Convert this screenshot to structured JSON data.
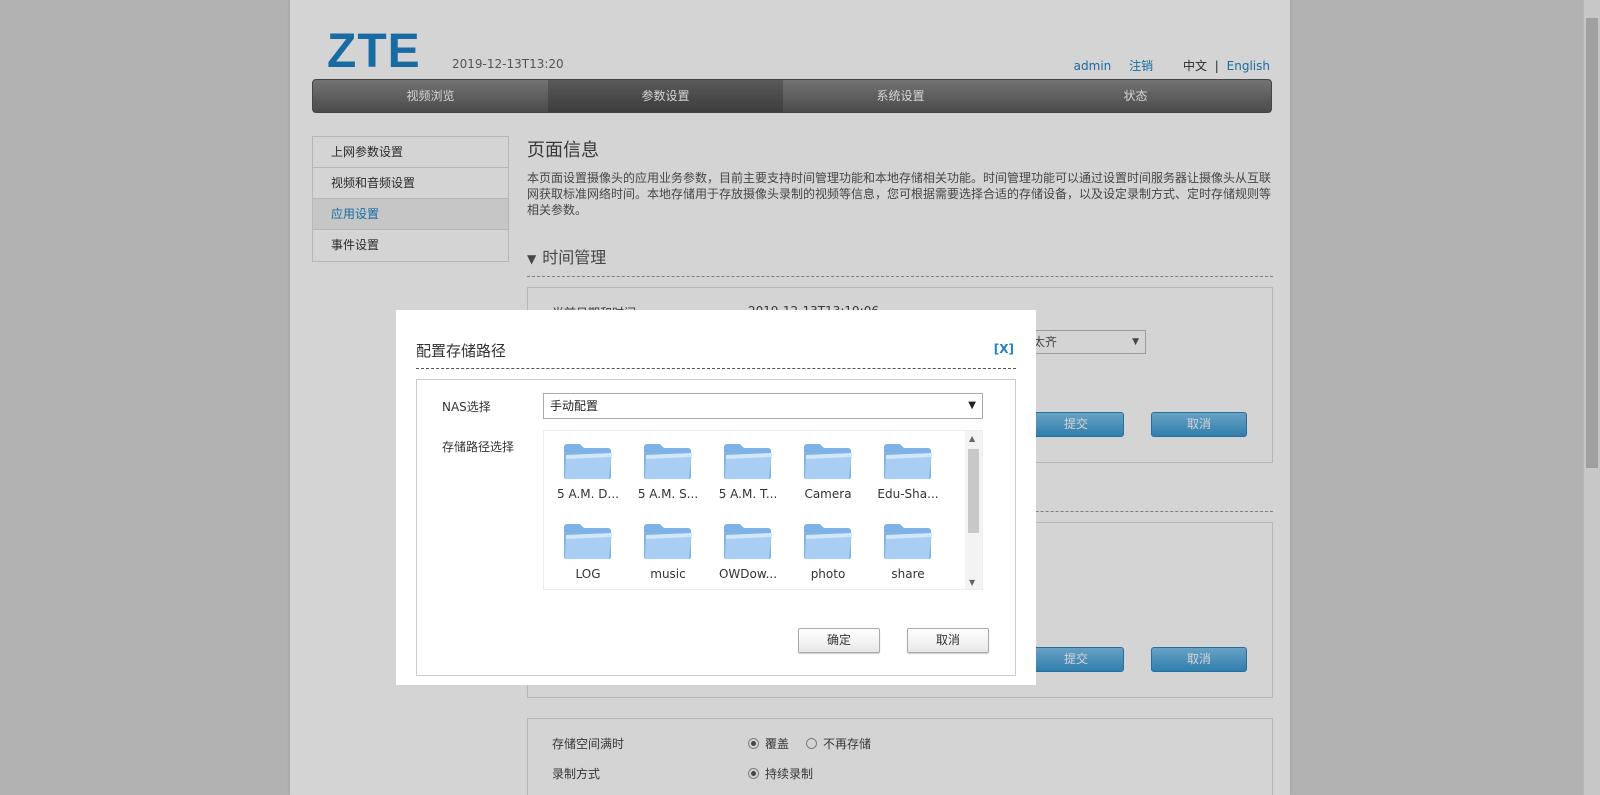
{
  "header": {
    "logo": "ZTE",
    "datetime": "2019-12-13T13:20",
    "user": "admin",
    "logout": "注销",
    "lang_zh": "中文",
    "lang_sep": "|",
    "lang_en": "English"
  },
  "nav": {
    "items": [
      "视频浏览",
      "参数设置",
      "系统设置",
      "状态"
    ],
    "active": "参数设置"
  },
  "sidebar": {
    "items": [
      "上网参数设置",
      "视频和音频设置",
      "应用设置",
      "事件设置"
    ],
    "active": "应用设置"
  },
  "main": {
    "title": "页面信息",
    "description": "本页面设置摄像头的应用业务参数，目前主要支持时间管理功能和本地存储相关功能。时间管理功能可以通过设置时间服务器让摄像头从互联网获取标准网络时间。本地存储用于存放摄像头录制的视频等信息，您可根据需要选择合适的存储设备，以及设定录制方式、定时存储规则等相关参数。",
    "section_time": "时间管理",
    "current_time_label": "当前日期和时间",
    "current_time_value": "2019-12-13T13:19:06",
    "timezone_partial": "太齐",
    "submit": "提交",
    "cancel": "取消",
    "storage_full_label": "存储空间满时",
    "overwrite": "覆盖",
    "stop_storage": "不再存储",
    "record_mode_label": "录制方式",
    "continuous_record": "持续录制"
  },
  "dialog": {
    "title": "配置存储路径",
    "close": "[X]",
    "nas_label": "NAS选择",
    "nas_value": "手动配置",
    "path_label": "存储路径选择",
    "folders": [
      "5 A.M. D...",
      "5 A.M. S...",
      "5 A.M. T...",
      "Camera",
      "Edu-Sha...",
      "LOG",
      "music",
      "OWDow...",
      "photo",
      "share"
    ],
    "ok": "确定",
    "cancel": "取消"
  },
  "colors": {
    "accent": "#1f82c5",
    "folder": "#a9cdf3",
    "nav_dark": "#5b5b5b"
  }
}
